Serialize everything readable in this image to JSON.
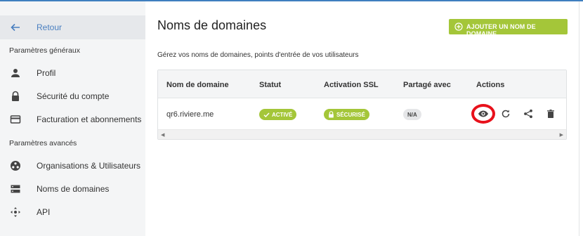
{
  "sidebar": {
    "back_label": "Retour",
    "general_title": "Paramètres généraux",
    "general_items": [
      {
        "label": "Profil",
        "icon": "person-icon"
      },
      {
        "label": "Sécurité du compte",
        "icon": "lock-icon"
      },
      {
        "label": "Facturation et abonnements",
        "icon": "credit-card-icon"
      }
    ],
    "advanced_title": "Paramètres avancés",
    "advanced_items": [
      {
        "label": "Organisations & Utilisateurs",
        "icon": "organization-icon"
      },
      {
        "label": "Noms de domaines",
        "icon": "server-icon"
      },
      {
        "label": "API",
        "icon": "api-icon"
      }
    ]
  },
  "main": {
    "title": "Noms de domaines",
    "add_button_label": "AJOUTER UN NOM DE DOMAINE",
    "description": "Gérez vos noms de domaines, points d'entrée de vos utilisateurs"
  },
  "table": {
    "headers": [
      "Nom de domaine",
      "Statut",
      "Activation SSL",
      "Partagé avec",
      "Actions"
    ],
    "rows": [
      {
        "domain": "qr6.riviere.me",
        "status": "ACTIVÉ",
        "ssl": "SÉCURISÉ",
        "shared": "N/A",
        "actions": [
          "eye-icon",
          "refresh-icon",
          "share-icon",
          "trash-icon"
        ]
      }
    ]
  },
  "colors": {
    "accent_green": "#a4c639",
    "link_blue": "#4a7fc0",
    "highlight_red": "#e8111b",
    "top_bar": "#3f7fbf"
  }
}
